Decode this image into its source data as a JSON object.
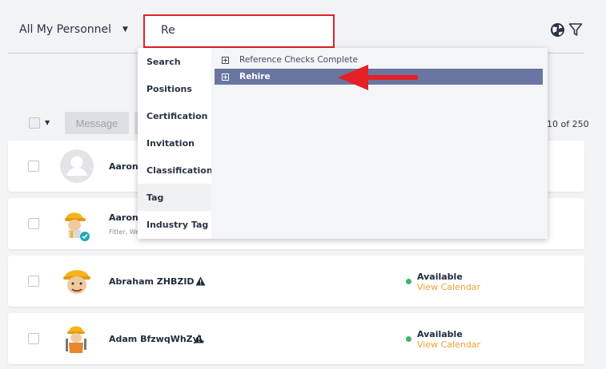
{
  "header": {
    "personnel_filter": "All My Personnel",
    "search_value": "Re"
  },
  "toolbar": {
    "message_label": "Message",
    "pagination": "10 of 250"
  },
  "dropdown": {
    "categories": [
      "Search",
      "Positions",
      "Certification",
      "Invitation",
      "Classification",
      "Tag",
      "Industry Tag"
    ],
    "results": [
      {
        "label": "Reference Checks Complete",
        "selected": false
      },
      {
        "label": "Rehire",
        "selected": true
      }
    ]
  },
  "rows": [
    {
      "name": "Aaron C",
      "subtitle": "",
      "avatar": "placeholder-avatar",
      "status": "",
      "calendar": ""
    },
    {
      "name": "Aaron I",
      "subtitle": "Fitter, We",
      "avatar": "worker-avatar-verified",
      "status": "",
      "calendar": ""
    },
    {
      "name": "Abraham ZHBZID",
      "subtitle": "",
      "avatar": "worker-avatar",
      "status": "Available",
      "calendar": "View Calendar"
    },
    {
      "name": "Adam BfzwqWhZyL",
      "subtitle": "",
      "avatar": "worker-avatar-tools",
      "status": "Available",
      "calendar": "View Calendar"
    }
  ],
  "colors": {
    "highlight_red": "#e32127",
    "selected_item": "#6a76a1",
    "available_green": "#3cb46e",
    "calendar_link": "#f0a030"
  },
  "icons": [
    "globe-icon",
    "filter-icon",
    "caret-down-icon",
    "plus-box-icon",
    "warning-icon",
    "verified-badge-icon"
  ]
}
